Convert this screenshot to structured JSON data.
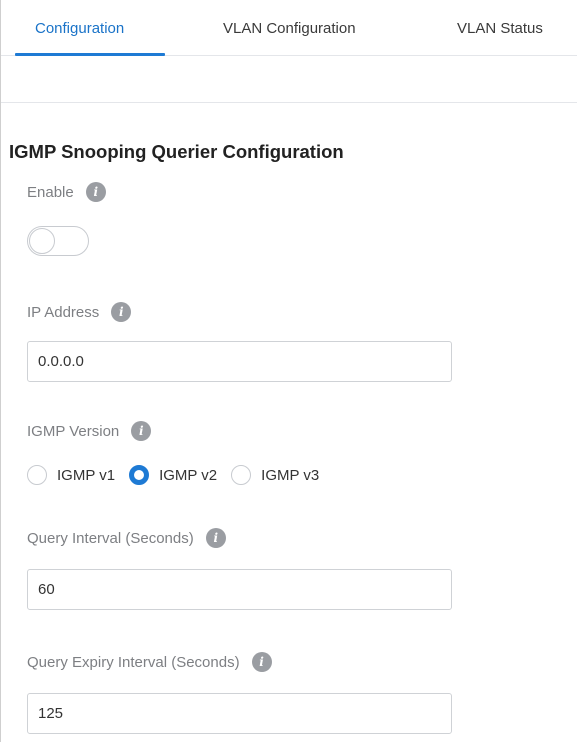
{
  "tabs": [
    {
      "label": "Configuration",
      "active": true
    },
    {
      "label": "VLAN Configuration",
      "active": false
    },
    {
      "label": "VLAN Status",
      "active": false
    }
  ],
  "section": {
    "title": "IGMP Snooping Querier Configuration"
  },
  "fields": {
    "enable": {
      "label": "Enable",
      "on": false
    },
    "ip_address": {
      "label": "IP Address",
      "value": "0.0.0.0"
    },
    "igmp_version": {
      "label": "IGMP Version",
      "options": [
        "IGMP v1",
        "IGMP v2",
        "IGMP v3"
      ],
      "selected": "IGMP v2"
    },
    "query_interval": {
      "label": "Query Interval (Seconds)",
      "value": "60"
    },
    "query_expiry_interval": {
      "label": "Query Expiry Interval (Seconds)",
      "value": "125"
    }
  },
  "icons": {
    "info_glyph": "i"
  },
  "colors": {
    "accent": "#1e7ad4",
    "label_gray": "#7d7f83",
    "info_icon_bg": "#9a9da2"
  }
}
